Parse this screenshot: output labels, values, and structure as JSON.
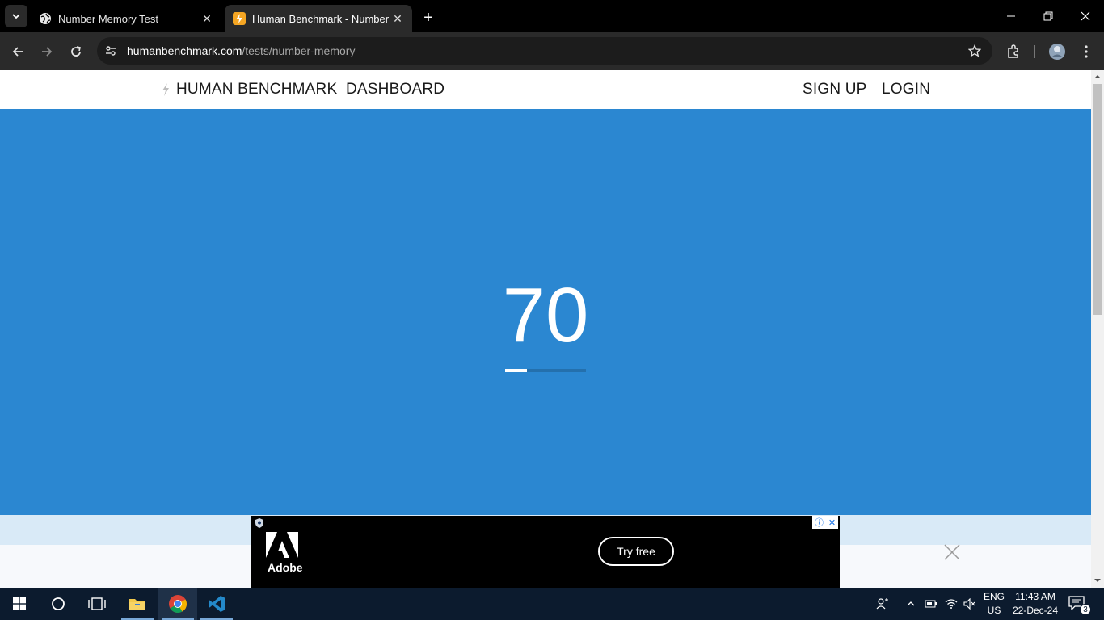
{
  "browser": {
    "tabs": [
      {
        "title": "Number Memory Test",
        "icon": "globe-icon",
        "active": false
      },
      {
        "title": "Human Benchmark - Number M",
        "icon": "bolt-favicon-icon",
        "active": true
      }
    ],
    "url_host": "humanbenchmark.com",
    "url_path": "/tests/number-memory"
  },
  "site": {
    "logo_text": "HUMAN BENCHMARK",
    "nav": {
      "dashboard": "DASHBOARD",
      "signup": "SIGN UP",
      "login": "LOGIN"
    }
  },
  "test": {
    "number": "70",
    "timer_progress_fraction": 0.27
  },
  "ad": {
    "brand": "Adobe",
    "cta": "Try free"
  },
  "taskbar": {
    "lang_top": "ENG",
    "lang_bottom": "US",
    "time": "11:43 AM",
    "date": "22-Dec-24",
    "notifications": "3"
  },
  "colors": {
    "hero_bg": "#2b87d1",
    "chrome_bg": "#2a2a2a",
    "taskbar_bg": "#0c1b2e"
  }
}
